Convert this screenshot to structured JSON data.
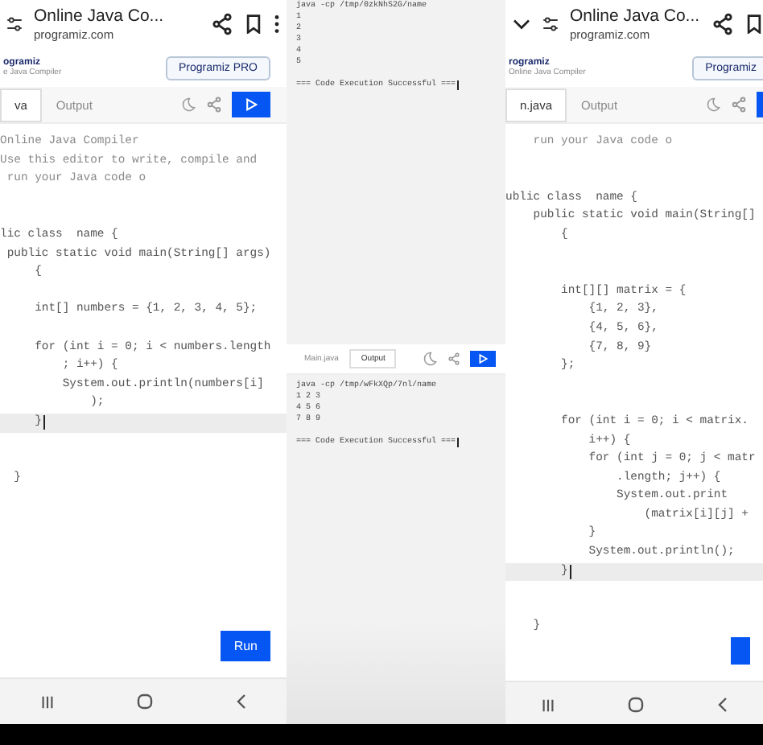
{
  "screens": [
    {
      "kind": "editor",
      "show_collapse": false,
      "header": {
        "title": "Online Java Co...",
        "url": "programiz.com"
      },
      "banner": {
        "brand": "ogramiz",
        "subtitle": "e Java Compiler",
        "button": "Programiz PRO"
      },
      "tabs": [
        {
          "label": "va",
          "selected": true
        },
        {
          "label": "Output",
          "selected": false
        }
      ],
      "code": [
        {
          "kind": "comment",
          "text": "Online Java Compiler",
          "current": false
        },
        {
          "kind": "comment",
          "text": "Use this editor to write, compile and",
          "current": false
        },
        {
          "kind": "comment",
          "text": " run your Java code o",
          "current": false
        },
        {
          "kind": "blank"
        },
        {
          "kind": "blank"
        },
        {
          "kind": "code",
          "text": "lic class  name {",
          "current": false
        },
        {
          "kind": "code",
          "text": " public static void main(String[] args)",
          "current": false
        },
        {
          "kind": "code",
          "text": "     {",
          "current": false
        },
        {
          "kind": "blank"
        },
        {
          "kind": "code",
          "text": "     int[] numbers = {1, 2, 3, 4, 5};",
          "current": false
        },
        {
          "kind": "blank"
        },
        {
          "kind": "code",
          "text": "     for (int i = 0; i < numbers.length",
          "current": false
        },
        {
          "kind": "code",
          "text": "         ; i++) {",
          "current": false
        },
        {
          "kind": "code",
          "text": "         System.out.println(numbers[i]",
          "current": false
        },
        {
          "kind": "code",
          "text": "             );",
          "current": false
        },
        {
          "kind": "code",
          "text": "     }",
          "current": true
        },
        {
          "kind": "blank"
        },
        {
          "kind": "blank"
        },
        {
          "kind": "code",
          "text": "  }",
          "current": false
        }
      ],
      "run_button": "Run",
      "run_button_edge": false
    },
    {
      "kind": "output",
      "top": {
        "lines": [
          "java -cp /tmp/0zkNhS2G/name",
          "1",
          "2",
          "3",
          "4",
          "5"
        ],
        "status": "=== Code Execution Successful ==="
      },
      "bottom": {
        "tabs": [
          {
            "label": "Main.java",
            "selected": false
          },
          {
            "label": "Output",
            "selected": true
          }
        ],
        "lines": [
          "java -cp /tmp/wFkXQp/7nl/name",
          "1 2 3",
          "4 5 6",
          "7 8 9"
        ],
        "status": "=== Code Execution Successful ==="
      }
    },
    {
      "kind": "editor",
      "show_collapse": true,
      "header": {
        "title": "Online Java Co...",
        "url": "programiz.com"
      },
      "banner": {
        "brand": "rogramiz",
        "subtitle": "Online Java Compiler",
        "button": "Programiz"
      },
      "tabs": [
        {
          "label": "n.java",
          "selected": true
        },
        {
          "label": "Output",
          "selected": false
        }
      ],
      "code": [
        {
          "kind": "comment",
          "text": "    run your Java code o",
          "current": false
        },
        {
          "kind": "blank"
        },
        {
          "kind": "blank"
        },
        {
          "kind": "code",
          "text": "ublic class  name {",
          "current": false
        },
        {
          "kind": "code",
          "text": "    public static void main(String[]",
          "current": false
        },
        {
          "kind": "code",
          "text": "        {",
          "current": false
        },
        {
          "kind": "blank"
        },
        {
          "kind": "blank"
        },
        {
          "kind": "code",
          "text": "        int[][] matrix = {",
          "current": false
        },
        {
          "kind": "code",
          "text": "            {1, 2, 3},",
          "current": false
        },
        {
          "kind": "code",
          "text": "            {4, 5, 6},",
          "current": false
        },
        {
          "kind": "code",
          "text": "            {7, 8, 9}",
          "current": false
        },
        {
          "kind": "code",
          "text": "        };",
          "current": false
        },
        {
          "kind": "blank"
        },
        {
          "kind": "blank"
        },
        {
          "kind": "code",
          "text": "        for (int i = 0; i < matrix.",
          "current": false
        },
        {
          "kind": "code",
          "text": "            i++) {",
          "current": false
        },
        {
          "kind": "code",
          "text": "            for (int j = 0; j < matr",
          "current": false
        },
        {
          "kind": "code",
          "text": "                .length; j++) {",
          "current": false
        },
        {
          "kind": "code",
          "text": "                System.out.print",
          "current": false
        },
        {
          "kind": "code",
          "text": "                    (matrix[i][j] +",
          "current": false
        },
        {
          "kind": "code",
          "text": "            }",
          "current": false
        },
        {
          "kind": "code",
          "text": "            System.out.println();",
          "current": false
        },
        {
          "kind": "code",
          "text": "        }",
          "current": true
        },
        {
          "kind": "blank"
        },
        {
          "kind": "blank"
        },
        {
          "kind": "code",
          "text": "    }",
          "current": false
        }
      ],
      "run_button_edge": true
    }
  ]
}
